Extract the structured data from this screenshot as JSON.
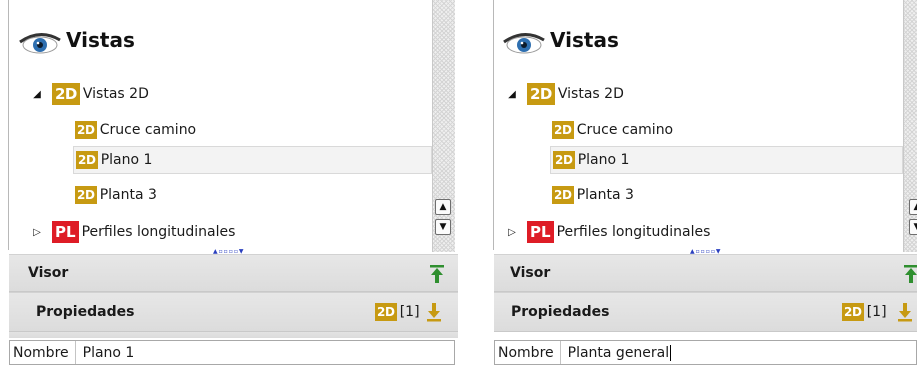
{
  "panels": [
    {
      "id": "left",
      "title": "Vistas",
      "group": {
        "badge": "2D",
        "label": "Vistas 2D"
      },
      "items": [
        {
          "badge": "2D",
          "label": "Cruce camino"
        },
        {
          "badge": "2D",
          "label": "Plano 1"
        },
        {
          "badge": "2D",
          "label": "Planta 3"
        }
      ],
      "collapsed_group": {
        "badge": "PL",
        "label": "Perfiles longitudinales"
      },
      "pager": "▲▫▫▫▫▼",
      "visor_label": "Visor",
      "propiedades_label": "Propiedades",
      "prop_badge": "2D",
      "prop_count": "[1]",
      "prop_name_label": "Nombre",
      "prop_name_value": "Plano 1"
    },
    {
      "id": "right",
      "title": "Vistas",
      "group": {
        "badge": "2D",
        "label": "Vistas 2D"
      },
      "items": [
        {
          "badge": "2D",
          "label": "Cruce camino"
        },
        {
          "badge": "2D",
          "label": "Plano 1"
        },
        {
          "badge": "2D",
          "label": "Planta 3"
        }
      ],
      "collapsed_group": {
        "badge": "PL",
        "label": "Perfiles longitudinales"
      },
      "pager": "▲▫▫▫▫▼",
      "visor_label": "Visor",
      "propiedades_label": "Propiedades",
      "prop_badge": "2D",
      "prop_count": "[1]",
      "prop_name_label": "Nombre",
      "prop_name_value": "Planta general"
    }
  ],
  "colors": {
    "badge_2d": "#c79a12",
    "badge_pl": "#de1c26",
    "arrow_green": "#2f8f2f",
    "arrow_gold": "#c79a12"
  },
  "icons": {
    "title": "eye-icon",
    "expanded": "triangle-down-icon",
    "collapsed": "triangle-right-icon",
    "visor_action": "pin-up-arrow-icon",
    "prop_action": "pin-down-arrow-icon",
    "scroll_up": "scroll-up-icon",
    "scroll_down": "scroll-down-icon"
  }
}
